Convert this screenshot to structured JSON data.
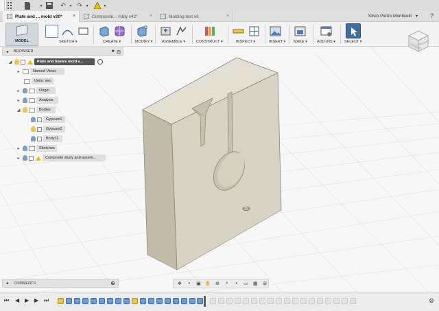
{
  "window": {
    "tabs": [
      {
        "label": "Plate and ... mold v20*",
        "active": true
      },
      {
        "label": "Composite... mbly v42*",
        "active": false
      },
      {
        "label": "Molding test v8",
        "active": false
      }
    ],
    "user_name": "Silvio Pietro Monticelli"
  },
  "toolbar": {
    "workspace_label": "MODEL",
    "groups": [
      {
        "label": "SKETCH"
      },
      {
        "label": "CREATE"
      },
      {
        "label": "MODIFY"
      },
      {
        "label": "ASSEMBLE"
      },
      {
        "label": "CONSTRUCT"
      },
      {
        "label": "INSPECT"
      },
      {
        "label": "INSERT"
      },
      {
        "label": "MAKE"
      },
      {
        "label": "ADD-INS"
      },
      {
        "label": "SELECT"
      }
    ]
  },
  "browser": {
    "title": "BROWSER",
    "root": "Plate and blades mold v...",
    "items": [
      {
        "label": "Named Views"
      },
      {
        "label": "Units: mm"
      },
      {
        "label": "Origin"
      },
      {
        "label": "Analysis"
      },
      {
        "label": "Bodies"
      },
      {
        "label": "Gypsum1"
      },
      {
        "label": "Gypsum2"
      },
      {
        "label": "Body11"
      },
      {
        "label": "Sketches"
      },
      {
        "label": "Composite study and assem..."
      }
    ]
  },
  "comments": {
    "title": "COMMENTS"
  },
  "colors": {
    "body_front": "#d9d3c5",
    "body_top": "#e4dfd3",
    "body_side": "#c2bba9",
    "selection_blue": "#3c6aa6"
  }
}
